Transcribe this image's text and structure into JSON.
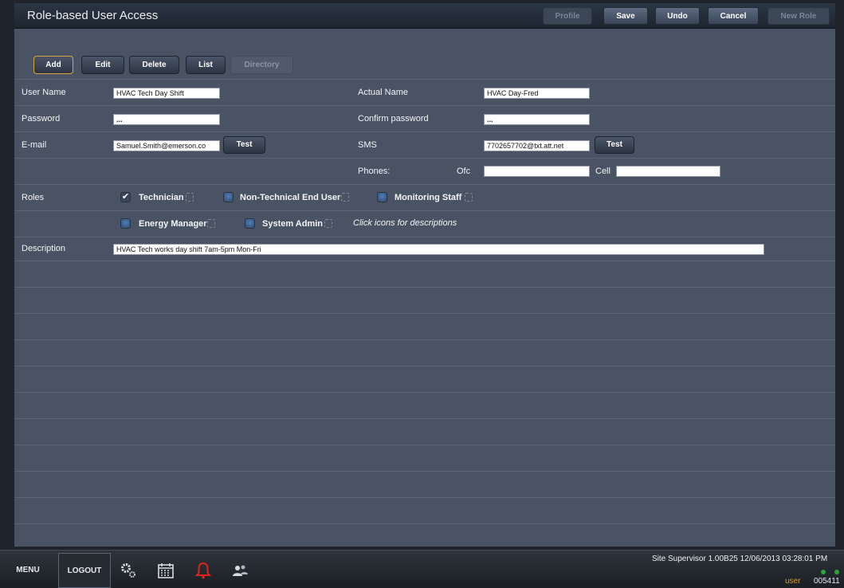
{
  "header": {
    "title": "Role-based User Access",
    "buttons": {
      "profile": "Profile",
      "save": "Save",
      "undo": "Undo",
      "cancel": "Cancel",
      "new_role": "New Role"
    }
  },
  "toolbar": {
    "add": "Add",
    "edit": "Edit",
    "delete": "Delete",
    "list": "List",
    "directory": "Directory"
  },
  "form": {
    "user_name_label": "User Name",
    "user_name_value": "HVAC Tech Day Shift",
    "actual_name_label": "Actual Name",
    "actual_name_value": "HVAC Day-Fred",
    "password_label": "Password",
    "password_value": "...",
    "confirm_password_label": "Confirm password",
    "confirm_password_value": "...",
    "email_label": "E-mail",
    "email_value": "Samuel.Smith@emerson.co",
    "email_test": "Test",
    "sms_label": "SMS",
    "sms_value": "7702657702@txt.att.net",
    "sms_test": "Test",
    "phones_label": "Phones:",
    "ofc_label": "Ofc",
    "ofc_value": "",
    "cell_label": "Cell",
    "cell_value": "",
    "roles_label": "Roles",
    "roles": [
      {
        "label": "Technician",
        "checked": true
      },
      {
        "label": "Non-Technical End User",
        "checked": false
      },
      {
        "label": "Monitoring Staff",
        "checked": false
      },
      {
        "label": "Energy Manager",
        "checked": false
      },
      {
        "label": "System Admin",
        "checked": false
      }
    ],
    "roles_hint": "Click icons for descriptions",
    "description_label": "Description",
    "description_value": "HVAC Tech works day shift 7am-5pm Mon-Fri"
  },
  "footer": {
    "menu": "MENU",
    "logout": "LOGOUT",
    "site_info": "Site Supervisor 1.00B25 12/06/2013 03:28:01 PM",
    "user_label": "user",
    "user_id": "005411"
  },
  "colors": {
    "accent_selected": "#d8a640",
    "alarm_red": "#e0241b",
    "status_green": "#2fa33a"
  }
}
